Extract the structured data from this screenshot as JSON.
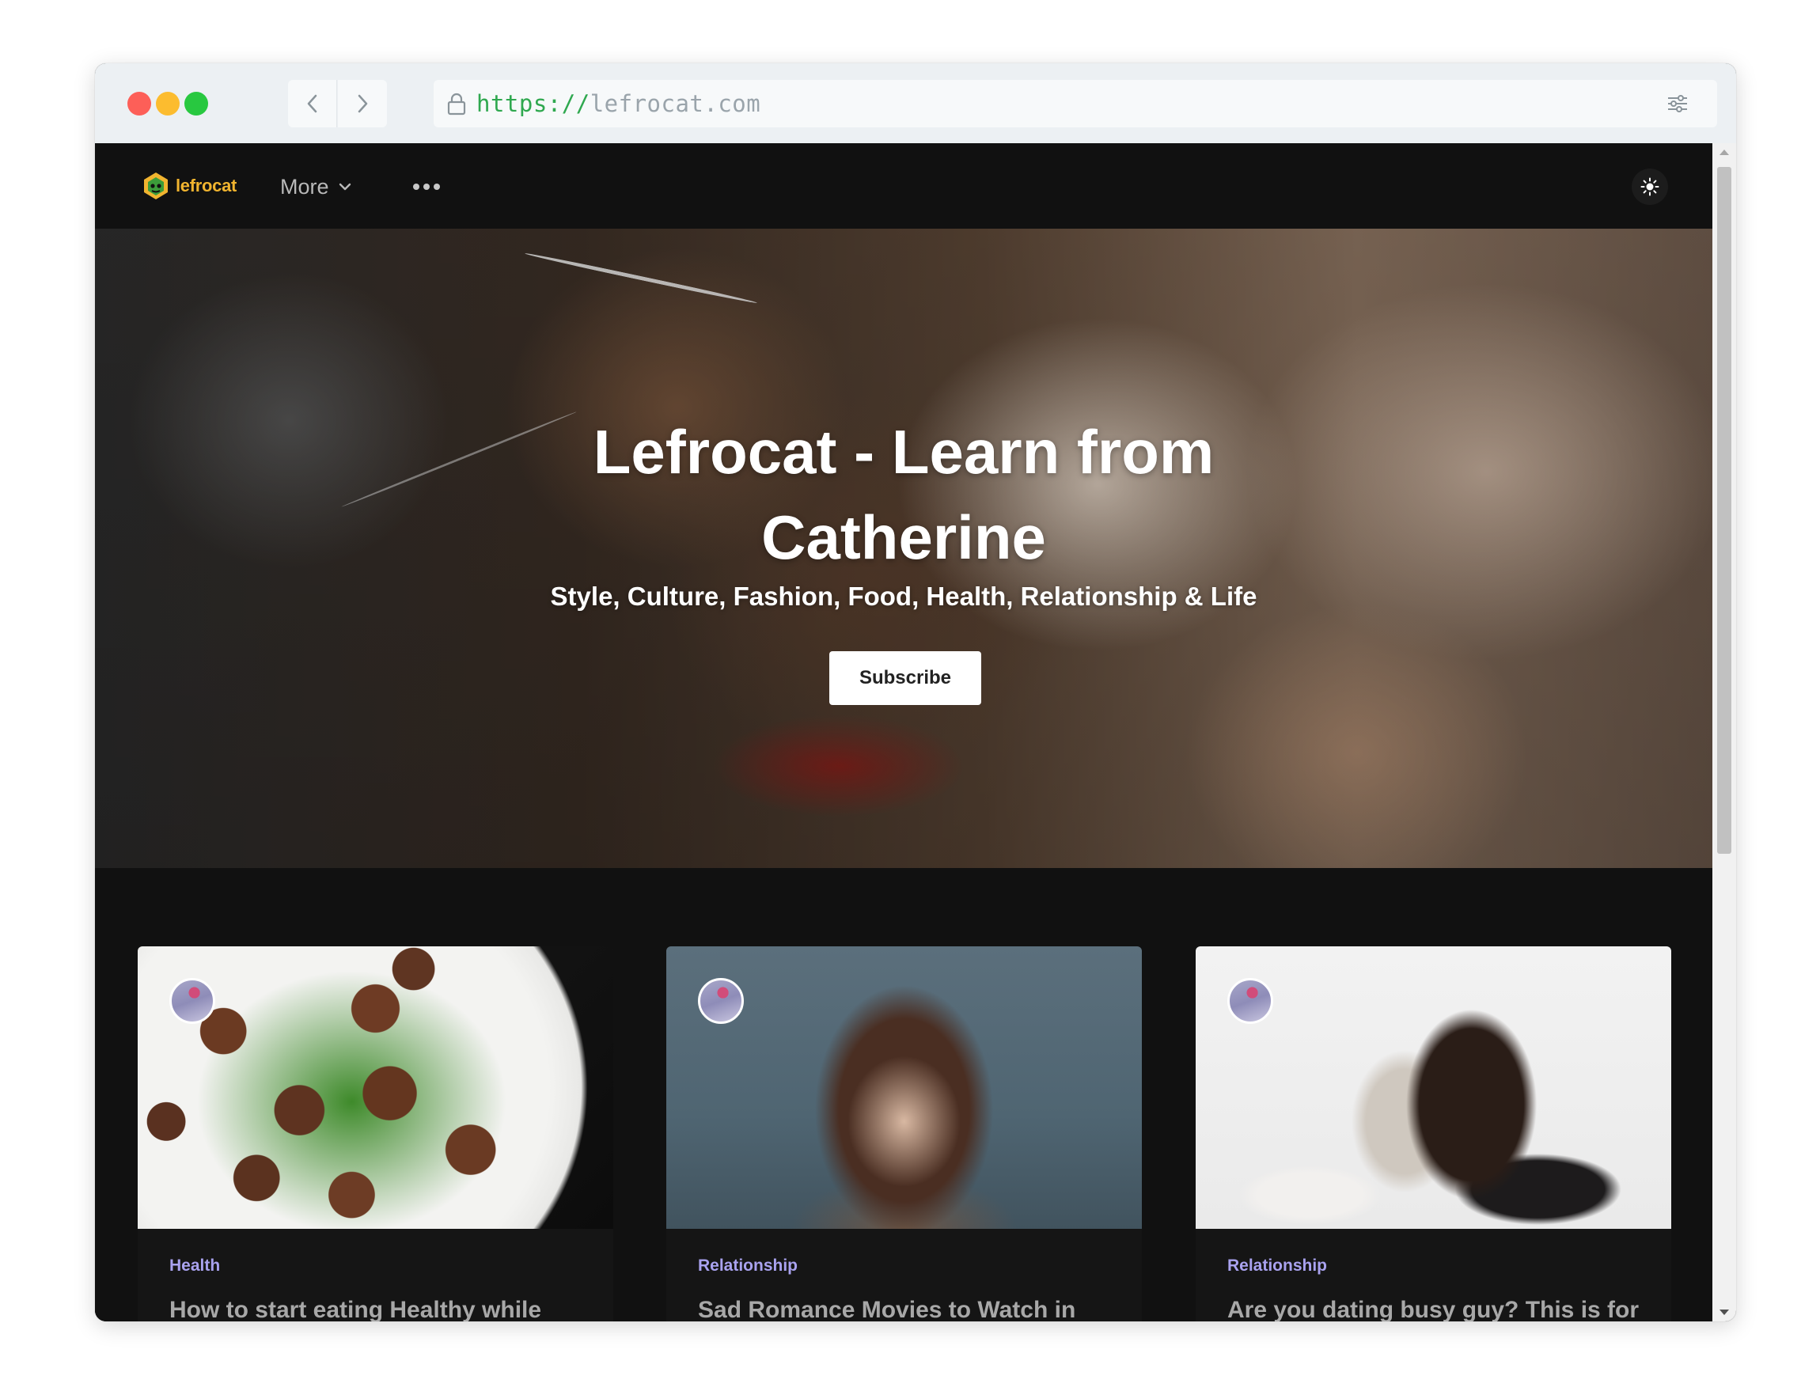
{
  "browser": {
    "url_scheme": "https://",
    "url_host": "lefrocat.com"
  },
  "site": {
    "logo_text": "lefrocat",
    "nav_more_label": "More",
    "theme_toggle_icon": "sun-icon"
  },
  "hero": {
    "title": "Lefrocat - Learn from Catherine",
    "subtitle": "Style, Culture, Fashion, Food, Health, Relationship & Life",
    "subscribe_label": "Subscribe"
  },
  "posts": [
    {
      "category": "Health",
      "title": "How to start eating Healthy while"
    },
    {
      "category": "Relationship",
      "title": "Sad Romance Movies to Watch in"
    },
    {
      "category": "Relationship",
      "title": "Are you dating busy guy? This is for"
    }
  ],
  "colors": {
    "brand": "#f1b42f",
    "category": "#a9a2ef",
    "page_bg": "#111111"
  }
}
